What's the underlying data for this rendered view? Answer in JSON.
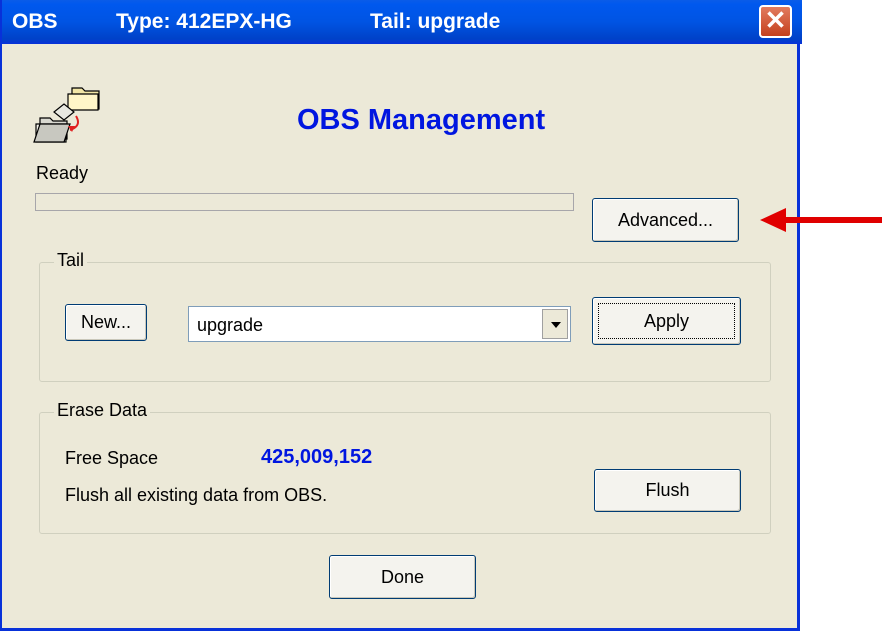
{
  "window": {
    "title_app": "OBS",
    "title_type": "Type: 412EPX-HG",
    "title_tail": "Tail: upgrade",
    "close_glyph": "✕"
  },
  "header": {
    "heading": "OBS Management",
    "logo_icon": "folder-transfer-icon"
  },
  "status": {
    "text": "Ready",
    "progress_fraction": 0
  },
  "buttons": {
    "advanced": "Advanced...",
    "new": "New...",
    "apply": "Apply",
    "flush": "Flush",
    "done": "Done"
  },
  "tail_group": {
    "legend": "Tail",
    "selected": "upgrade"
  },
  "erase_group": {
    "legend": "Erase Data",
    "free_space_label": "Free Space",
    "free_space_value": "425,009,152",
    "flush_description": "Flush all existing data from OBS."
  },
  "colors": {
    "accent_blue": "#0016e0",
    "titlebar_blue": "#0054e3",
    "dialog_bg": "#ece9d8",
    "annotation_arrow": "#e00000"
  }
}
